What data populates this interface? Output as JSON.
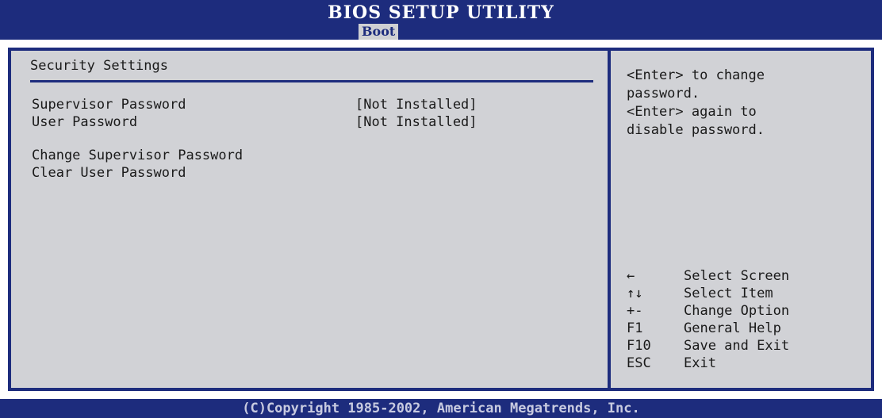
{
  "header": {
    "title": "BIOS SETUP UTILITY",
    "active_tab": "Boot"
  },
  "main": {
    "section_title": "Security Settings",
    "items": [
      {
        "label": "Supervisor Password",
        "value": "[Not Installed]"
      },
      {
        "label": "User Password",
        "value": "[Not Installed]"
      },
      {
        "label": "Change Supervisor Password"
      },
      {
        "label": "Clear User Password"
      }
    ]
  },
  "help": {
    "text": "<Enter> to change\npassword.\n<Enter> again to\ndisable password."
  },
  "keys": [
    {
      "key": "←",
      "icon": "arrow-left-icon",
      "desc": "Select Screen"
    },
    {
      "key": "↑↓",
      "icon": "arrow-up-down-icon",
      "desc": "Select Item"
    },
    {
      "key": "+-",
      "desc": "Change Option"
    },
    {
      "key": "F1",
      "desc": "General Help"
    },
    {
      "key": "F10",
      "desc": "Save and Exit"
    },
    {
      "key": "ESC",
      "desc": "Exit"
    }
  ],
  "footer": {
    "copyright": "(C)Copyright 1985-2002, American Megatrends, Inc."
  },
  "colors": {
    "bar_blue": "#1d2c7d",
    "panel_grey": "#d1d2d6",
    "text": "#1a1a1a"
  }
}
